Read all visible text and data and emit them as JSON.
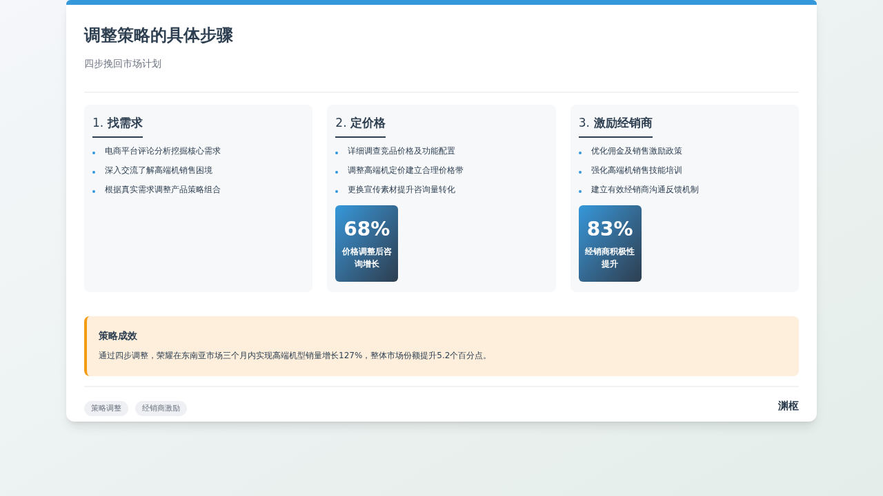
{
  "title": "调整策略的具体步骤",
  "subtitle": "四步挽回市场计划",
  "steps": [
    {
      "number": "1.",
      "title": "找需求",
      "bullets": [
        "电商平台评论分析挖掘核心需求",
        "深入交流了解高端机销售困境",
        "根据真实需求调整产品策略组合"
      ]
    },
    {
      "number": "2.",
      "title": "定价格",
      "bullets": [
        "详细调查竞品价格及功能配置",
        "调整高端机定价建立合理价格带",
        "更换宣传素材提升咨询量转化"
      ],
      "stat": {
        "value": "68%",
        "label": "价格调整后咨询增长"
      }
    },
    {
      "number": "3.",
      "title": "激励经销商",
      "bullets": [
        "优化佣金及销售激励政策",
        "强化高端机销售技能培训",
        "建立有效经销商沟通反馈机制"
      ],
      "stat": {
        "value": "83%",
        "label": "经销商积极性提升"
      }
    }
  ],
  "result": {
    "title": "策略成效",
    "text": "通过四步调整，荣耀在东南亚市场三个月内实现高端机型销量增长127%，整体市场份额提升5.2个百分点。"
  },
  "tags": [
    "策略调整",
    "经销商激励"
  ],
  "brand": "渊枢"
}
